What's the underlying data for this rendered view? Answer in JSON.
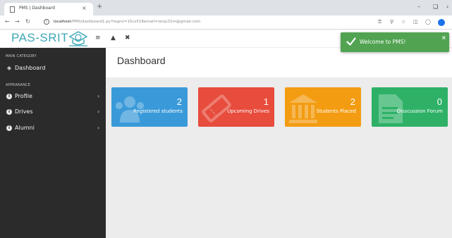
{
  "browser": {
    "tab_title": "PMS | Dashboard",
    "tab_close": "×",
    "new_tab": "+",
    "url_host": "localhost",
    "url_path": "/PMS/dashboard1.py?regno=15cs518email=renju31m@gmail.com",
    "icons": [
      "back-icon",
      "forward-icon",
      "reload-icon",
      "key-icon",
      "zoom-icon",
      "star-icon",
      "extension-icon",
      "profile-icon"
    ]
  },
  "header": {
    "brand": "PAS-SRIT",
    "brand_color": "#3aa8b6"
  },
  "sidebar": {
    "category_main": "MAIN CATEGORY",
    "category_appearance": "APPEARANCE",
    "dashboard": "Dashboard",
    "items": [
      {
        "label": "Profile"
      },
      {
        "label": "Drives"
      },
      {
        "label": "Alumni"
      }
    ]
  },
  "main": {
    "title": "Dashboard",
    "cards": [
      {
        "count": "2",
        "label": "Registered students",
        "color": "#3a9ad9",
        "icon": "users-icon"
      },
      {
        "count": "1",
        "label": "Upcoming Drives",
        "color": "#e74c3c",
        "icon": "ticket-icon"
      },
      {
        "count": "2",
        "label": "Students Placed",
        "color": "#f39c12",
        "icon": "bank-icon"
      },
      {
        "count": "0",
        "label": "Disscussion Forum",
        "color": "#2eb167",
        "icon": "document-icon"
      }
    ]
  },
  "toast": {
    "message": "Welcome to PMS!",
    "close": "×",
    "color": "#51a351"
  }
}
